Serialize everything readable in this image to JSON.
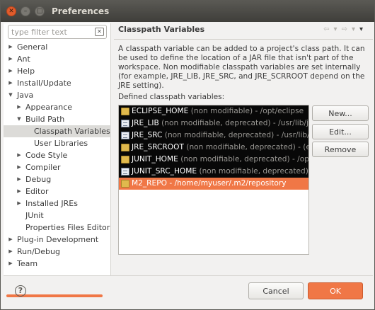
{
  "window": {
    "title": "Preferences"
  },
  "filter": {
    "placeholder": "type filter text"
  },
  "tree": [
    {
      "label": "General",
      "arrow": "▶",
      "indent": 0
    },
    {
      "label": "Ant",
      "arrow": "▶",
      "indent": 0
    },
    {
      "label": "Help",
      "arrow": "▶",
      "indent": 0
    },
    {
      "label": "Install/Update",
      "arrow": "▶",
      "indent": 0
    },
    {
      "label": "Java",
      "arrow": "▼",
      "indent": 0
    },
    {
      "label": "Appearance",
      "arrow": "▶",
      "indent": 1
    },
    {
      "label": "Build Path",
      "arrow": "▼",
      "indent": 1
    },
    {
      "label": "Classpath Variables",
      "arrow": "",
      "indent": 2,
      "selected": true
    },
    {
      "label": "User Libraries",
      "arrow": "",
      "indent": 2
    },
    {
      "label": "Code Style",
      "arrow": "▶",
      "indent": 1
    },
    {
      "label": "Compiler",
      "arrow": "▶",
      "indent": 1
    },
    {
      "label": "Debug",
      "arrow": "▶",
      "indent": 1
    },
    {
      "label": "Editor",
      "arrow": "▶",
      "indent": 1
    },
    {
      "label": "Installed JREs",
      "arrow": "▶",
      "indent": 1
    },
    {
      "label": "JUnit",
      "arrow": "",
      "indent": 1
    },
    {
      "label": "Properties Files Editor",
      "arrow": "",
      "indent": 1
    },
    {
      "label": "Plug-in Development",
      "arrow": "▶",
      "indent": 0
    },
    {
      "label": "Run/Debug",
      "arrow": "▶",
      "indent": 0
    },
    {
      "label": "Team",
      "arrow": "▶",
      "indent": 0
    }
  ],
  "page": {
    "title": "Classpath Variables",
    "description": "A classpath variable can be added to a project's class path. It can be used to define the location of a JAR file that isn't part of the workspace. Non modifiable classpath variables are set internally (for example, JRE_LIB, JRE_SRC, and JRE_SCRROOT depend on the JRE setting).",
    "list_label": "Defined classpath variables:"
  },
  "variables": [
    {
      "name": "ECLIPSE_HOME",
      "detail": " (non modifiable) - /opt/eclipse",
      "icon": "folder",
      "style": "dark"
    },
    {
      "name": "JRE_LIB",
      "detail": " (non modifiable, deprecated) - /usr/lib/jvm",
      "icon": "jar",
      "style": "dark"
    },
    {
      "name": "JRE_SRC",
      "detail": " (non modifiable, deprecated) - /usr/lib/jvm",
      "icon": "jar",
      "style": "dark"
    },
    {
      "name": "JRE_SRCROOT",
      "detail": " (non modifiable, deprecated) - (em",
      "icon": "folder",
      "style": "dark"
    },
    {
      "name": "JUNIT_HOME",
      "detail": " (non modifiable, deprecated) - /opt/",
      "icon": "folder",
      "style": "dark"
    },
    {
      "name": "JUNIT_SRC_HOME",
      "detail": " (non modifiable, deprecated) - /opt/",
      "icon": "jar",
      "style": "dark"
    },
    {
      "name": "M2_REPO",
      "detail": " - /home/myuser/.m2/repository",
      "icon": "folder",
      "style": "selected"
    }
  ],
  "buttons": {
    "new": "New...",
    "edit": "Edit...",
    "remove": "Remove"
  },
  "dialog": {
    "cancel": "Cancel",
    "ok": "OK",
    "help": "?"
  },
  "nav": {
    "back": "⇦",
    "back_menu": "▾",
    "forward": "⇨",
    "forward_menu": "▾",
    "menu": "▾"
  },
  "colors": {
    "accent": "#f07746",
    "dark_row": "#080808"
  }
}
